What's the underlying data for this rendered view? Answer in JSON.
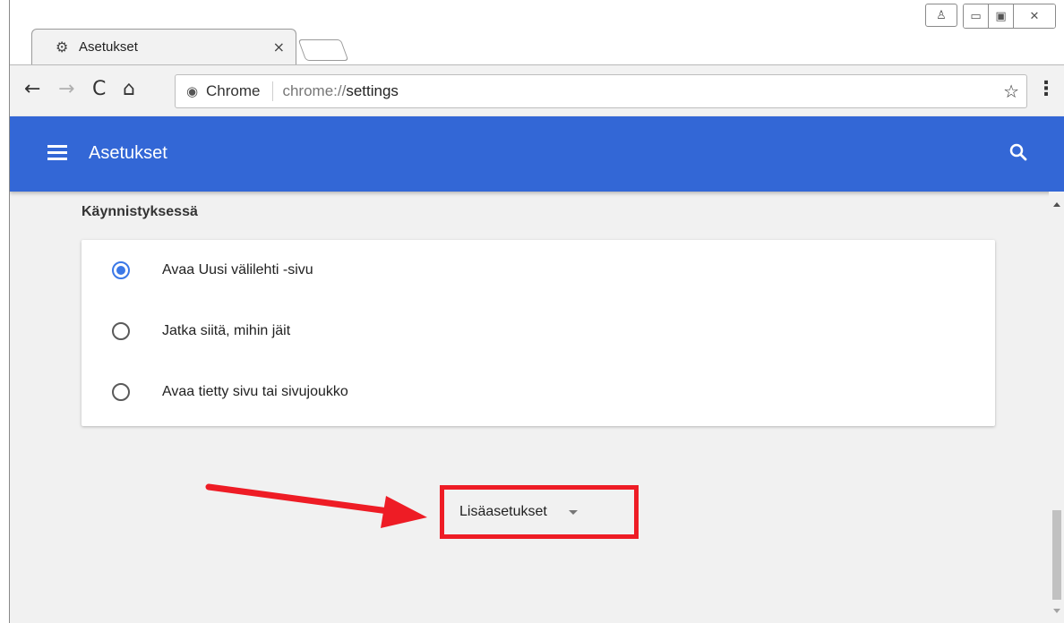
{
  "browser": {
    "tab": {
      "title": "Asetukset",
      "icon": "gear-icon",
      "close_glyph": "×"
    },
    "toolbar": {
      "back_glyph": "←",
      "forward_glyph": "→",
      "reload_glyph": "C",
      "home_glyph": "⌂",
      "site_chip_label": "Chrome",
      "url_scheme": "chrome://",
      "url_path": "settings",
      "bookmark_glyph": "☆",
      "menu_glyph": "⋮"
    },
    "window_controls": {
      "user_glyph": "♙",
      "minimize_glyph": "▭",
      "restore_glyph": "▣",
      "close_glyph": "✕"
    }
  },
  "app_header": {
    "title": "Asetukset"
  },
  "startup": {
    "section_title": "Käynnistyksessä",
    "options": [
      {
        "label": "Avaa Uusi välilehti -sivu",
        "selected": true
      },
      {
        "label": "Jatka siitä, mihin jäit",
        "selected": false
      },
      {
        "label": "Avaa tietty sivu tai sivujoukko",
        "selected": false
      }
    ]
  },
  "advanced": {
    "label": "Lisäasetukset"
  },
  "colors": {
    "header_blue": "#3367d6",
    "radio_blue": "#3b78e7",
    "annotation_red": "#ee1c25"
  }
}
